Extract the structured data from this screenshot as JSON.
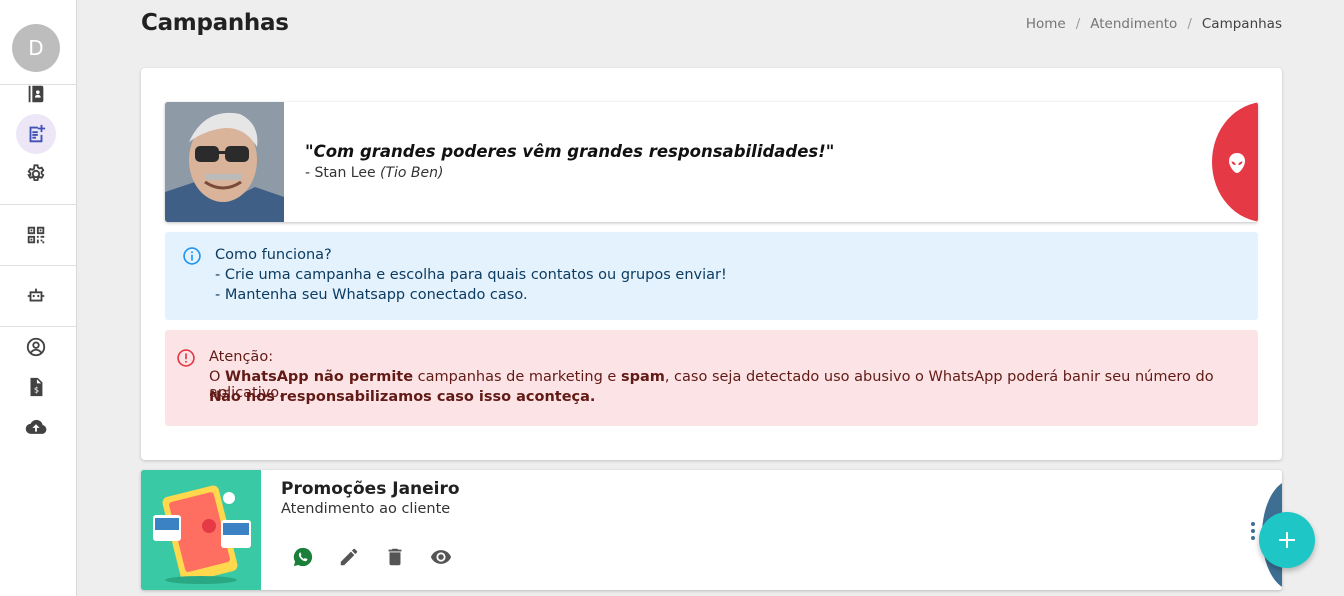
{
  "sidebar": {
    "avatar_initial": "D",
    "items": [
      {
        "icon": "contacts-book-icon"
      },
      {
        "icon": "campaign-note-icon",
        "active": true
      },
      {
        "icon": "gear-icon"
      },
      {
        "icon": "qr-code-icon"
      },
      {
        "icon": "bot-icon"
      },
      {
        "icon": "user-circle-icon"
      },
      {
        "icon": "invoice-icon"
      },
      {
        "icon": "cloud-upload-icon"
      }
    ]
  },
  "header": {
    "title": "Campanhas",
    "breadcrumb": [
      "Home",
      "Atendimento",
      "Campanhas"
    ],
    "breadcrumb_sep": "/"
  },
  "quote": {
    "text": "\"Com grandes poderes vêm grandes responsabilidades!\"",
    "author_prefix": "- Stan Lee ",
    "author_alias": "(Tio Ben)"
  },
  "info": {
    "title": "Como funciona?",
    "lines": [
      "- Crie uma campanha e escolha para quais contatos ou grupos enviar!",
      "- Mantenha seu Whatsapp conectado caso."
    ]
  },
  "warning": {
    "title": "Atenção:",
    "l2_a": "O ",
    "l2_b": "WhatsApp não permite",
    "l2_c": " campanhas de marketing e ",
    "l2_d": "spam",
    "l2_e": ", caso seja detectado uso abusivo o WhatsApp poderá banir seu número do aplicativo.",
    "l3": "Não nos responsabilizamos caso isso aconteça."
  },
  "campaign": {
    "title": "Promoções Janeiro",
    "subtitle": "Atendimento ao cliente"
  },
  "colors": {
    "accent": "#1ec6c6",
    "danger": "#e53945",
    "info_bg": "#e3f2fd",
    "warn_bg": "#fce4e6"
  }
}
